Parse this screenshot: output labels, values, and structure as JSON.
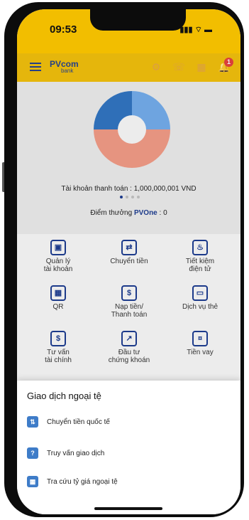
{
  "status_bar": {
    "time": "09:53",
    "indicators": "▮▮▮ ⌔ ▬"
  },
  "app_bar": {
    "logo": "PVcom",
    "logo_sub": "bank",
    "notification_count": "1",
    "icons": [
      "menu-icon",
      "settings-icon",
      "call-icon",
      "qr-icon",
      "bell-icon"
    ]
  },
  "summary": {
    "account_label": "Tài khoản thanh toán : 1,000,000,001 VND",
    "points_label": "Điểm thưởng ",
    "points_brand": "PVOne",
    "points_value": " : 0",
    "donut_colors": [
      "#2f6fb8",
      "#6ea4e0",
      "#e69480"
    ]
  },
  "grid": {
    "items": [
      {
        "label": "Quản lý\ntài khoản",
        "icon": "wallet-icon"
      },
      {
        "label": "Chuyển tiền",
        "icon": "transfer-icon"
      },
      {
        "label": "Tiết kiệm\nđiện tử",
        "icon": "piggy-bank-icon"
      },
      {
        "label": "QR",
        "icon": "qr-code-icon"
      },
      {
        "label": "Nạp tiền/\nThanh toán",
        "icon": "topup-icon"
      },
      {
        "label": "Dịch vụ thẻ",
        "icon": "card-icon"
      },
      {
        "label": "Tư vấn\ntài chính",
        "icon": "calendar-icon"
      },
      {
        "label": "Đầu tư\nchứng khoán",
        "icon": "chart-icon"
      },
      {
        "label": "Tiền vay",
        "icon": "loan-icon"
      }
    ]
  },
  "sheet": {
    "title": "Giao dịch ngoại tệ",
    "items": [
      {
        "label": "Chuyển tiền quốc tế",
        "icon": "international-transfer-icon"
      },
      {
        "label": "Truy vấn giao dịch",
        "icon": "transaction-query-icon"
      },
      {
        "label": "Tra cứu tỷ giá ngoại tệ",
        "icon": "exchange-rate-icon"
      }
    ]
  }
}
